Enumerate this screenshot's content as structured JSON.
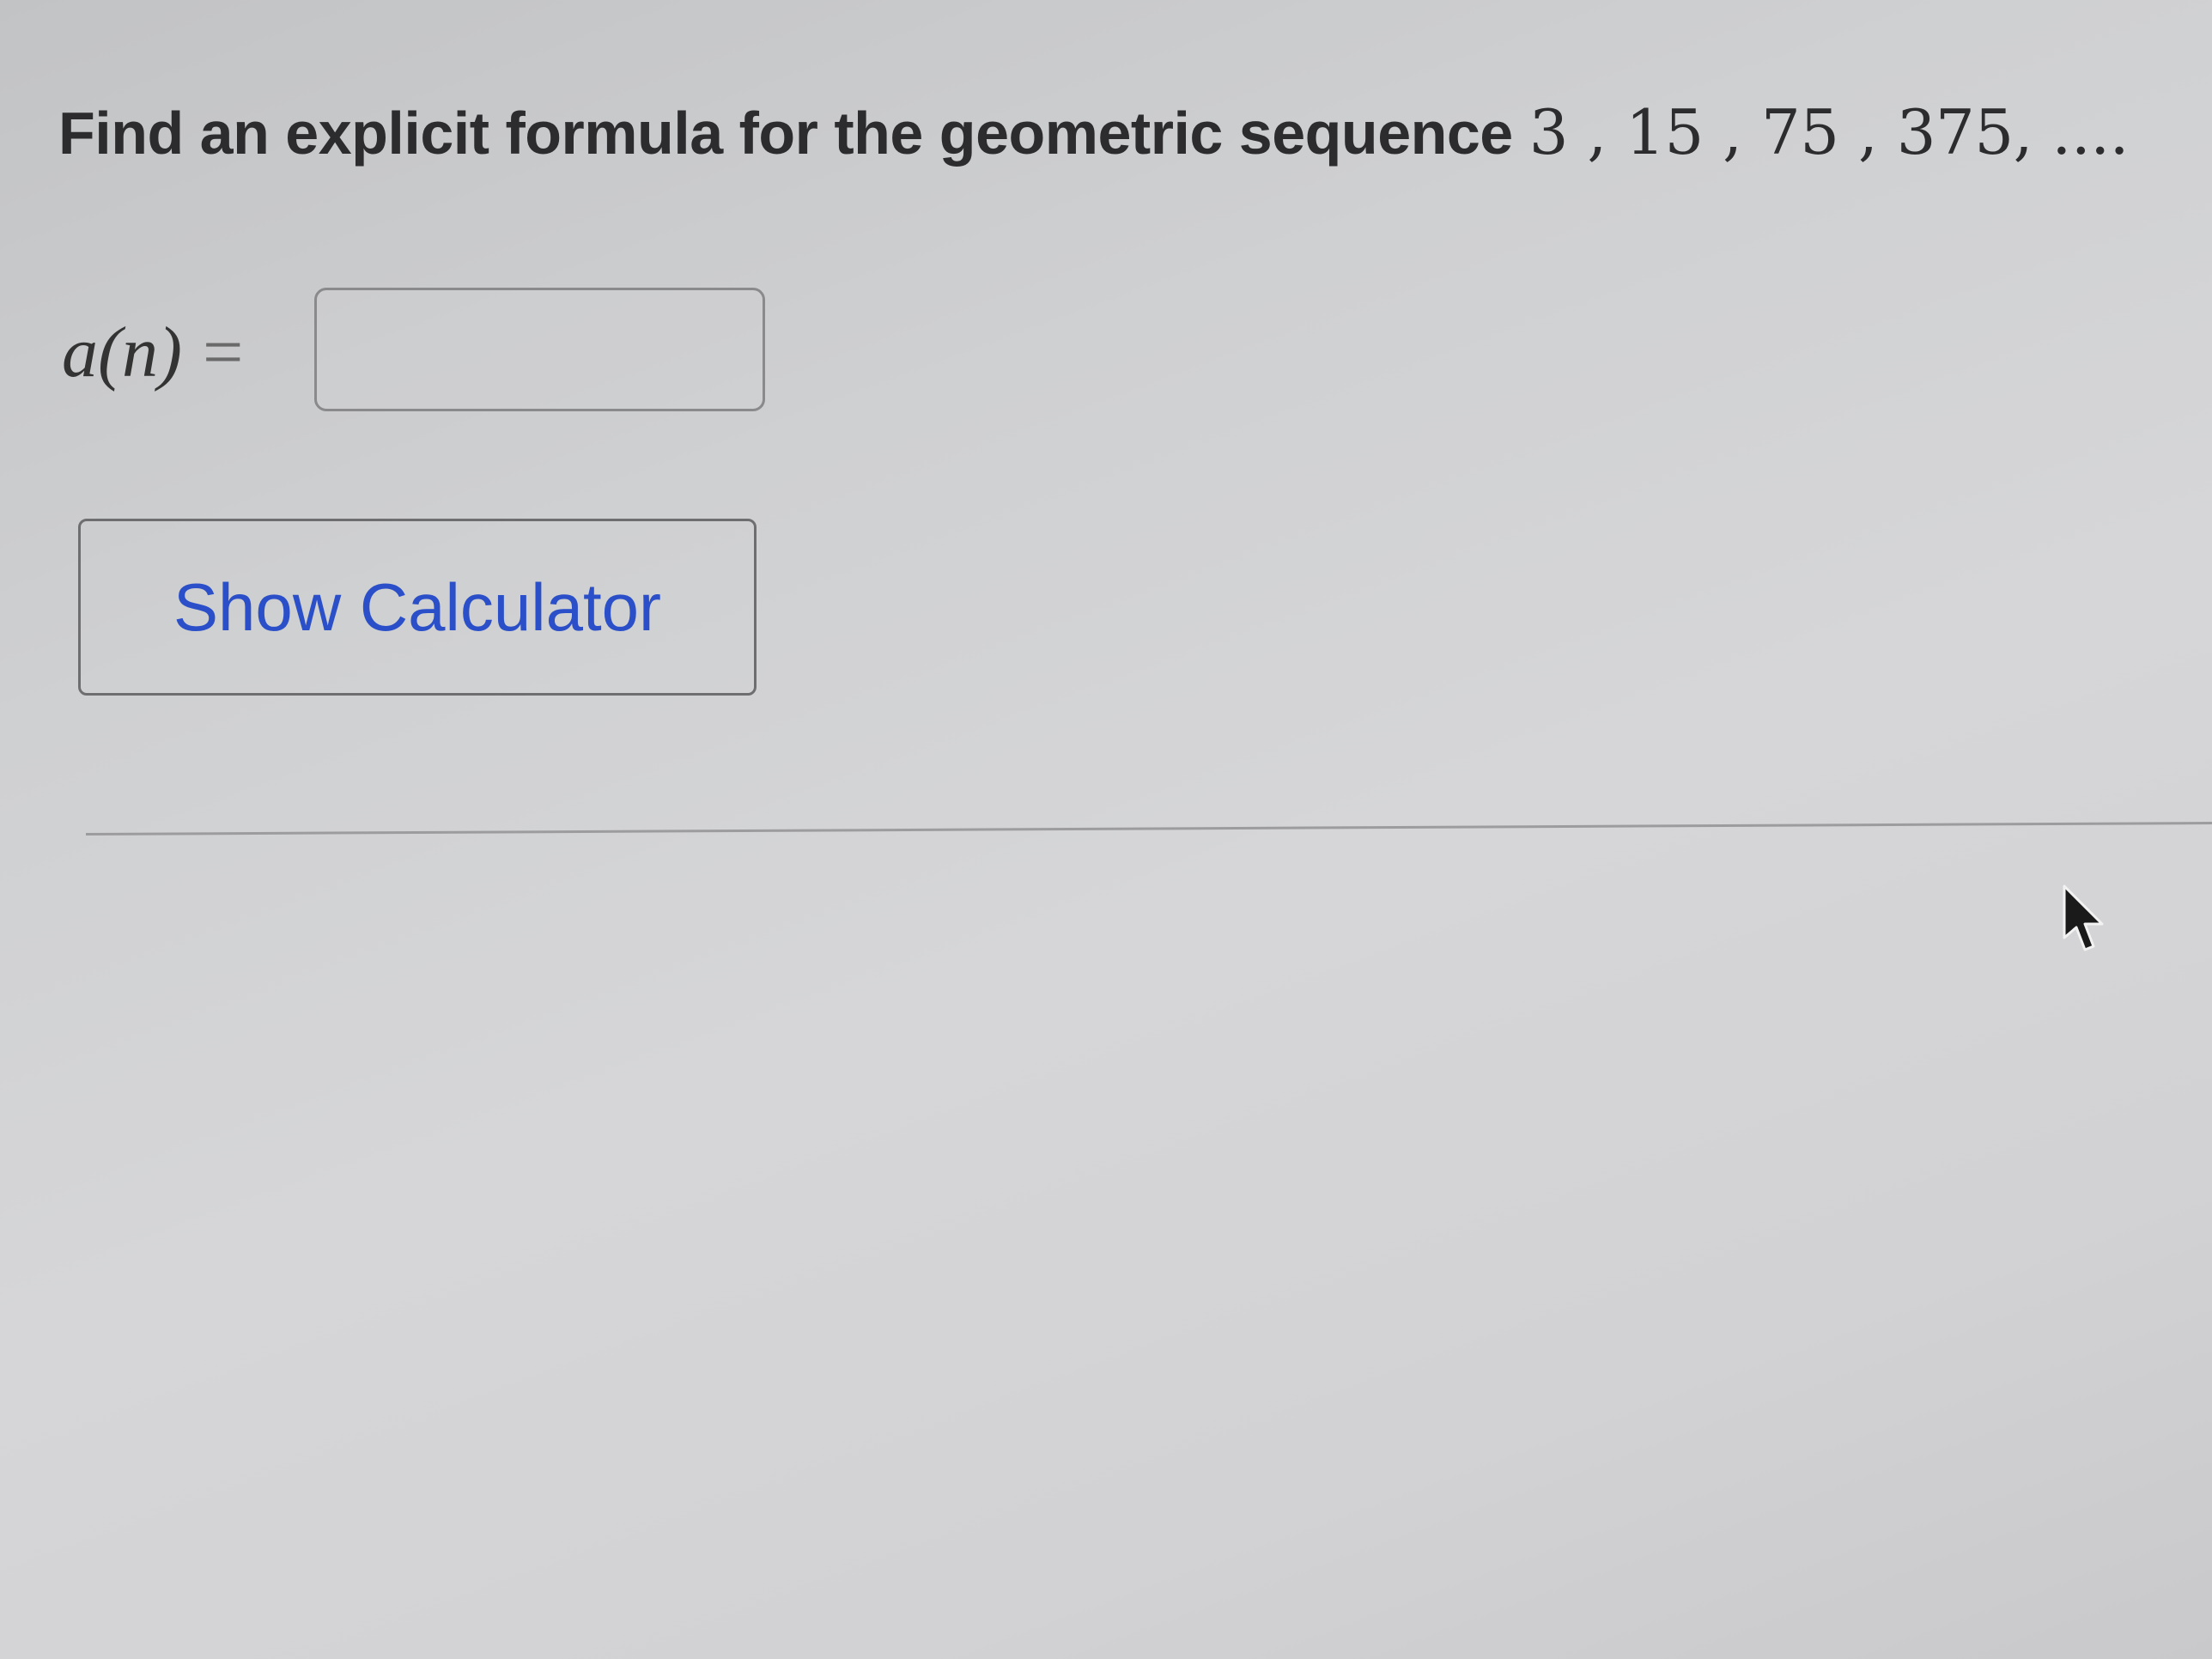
{
  "question": {
    "prompt": "Find an explicit formula for the geometric sequence",
    "sequence": "3 , 15 , 75 , 375, ...."
  },
  "answer": {
    "label": "a(n)",
    "equals": "=",
    "value": "",
    "placeholder": ""
  },
  "calculator_button": {
    "label": "Show Calculator"
  },
  "colors": {
    "button_text": "#2a4fc8",
    "background": "#d0d0d2",
    "border": "#8a8a8c"
  },
  "icons": {
    "cursor": "mouse-pointer-icon"
  }
}
